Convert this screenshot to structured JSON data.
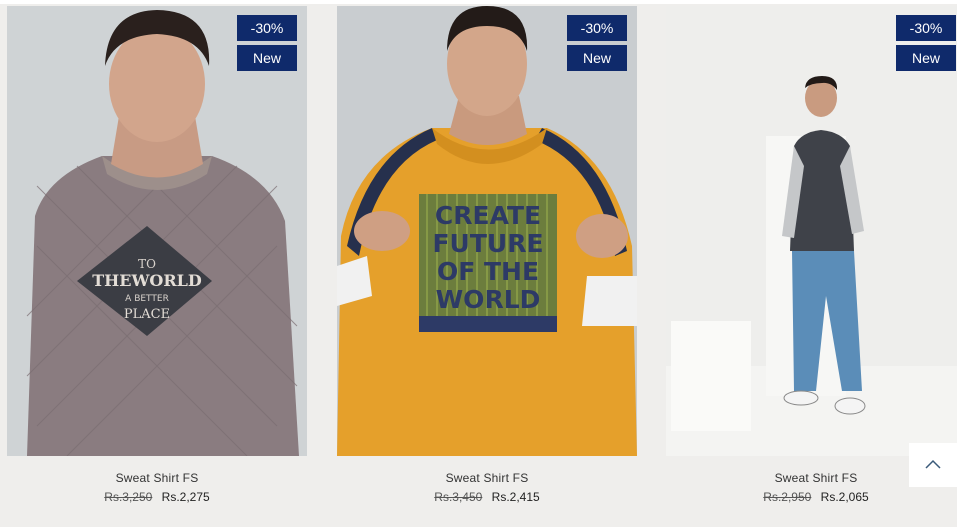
{
  "products": [
    {
      "name": "Sweat Shirt FS",
      "old_price": "Rs.3,250",
      "new_price": "Rs.2,275",
      "discount_badge": "-30%",
      "new_badge": "New",
      "print_text": "TO THE WORLD A BETTER PLACE"
    },
    {
      "name": "Sweat Shirt FS",
      "old_price": "Rs.3,450",
      "new_price": "Rs.2,415",
      "discount_badge": "-30%",
      "new_badge": "New",
      "print_text": "CREATE FUTURE OF THE WORLD"
    },
    {
      "name": "Sweat Shirt FS",
      "old_price": "Rs.2,950",
      "new_price": "Rs.2,065",
      "discount_badge": "-30%",
      "new_badge": "New"
    }
  ],
  "icons": {
    "scroll_top": "chevron-up-icon"
  },
  "colors": {
    "badge_background": "#0f2a6b",
    "page_background": "#efeeec"
  }
}
